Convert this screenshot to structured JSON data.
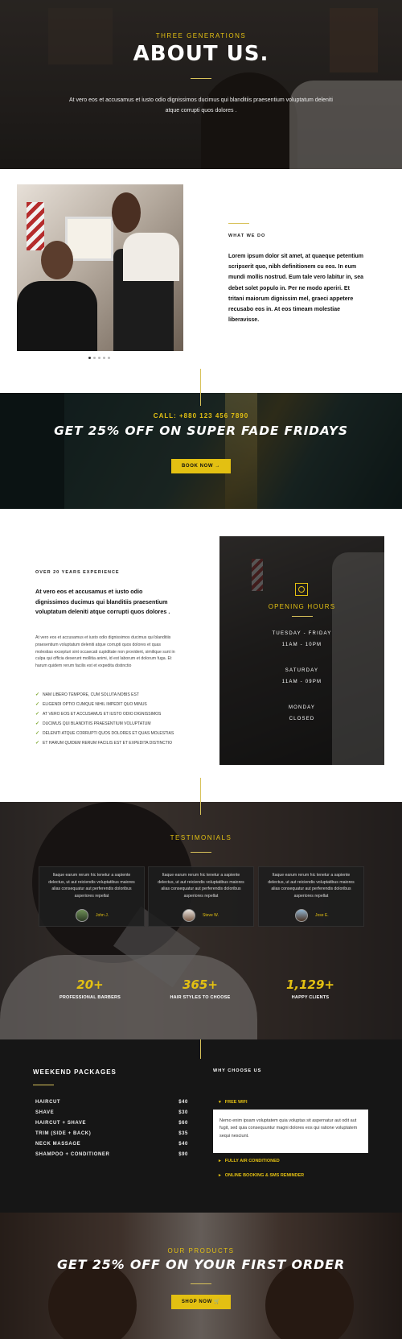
{
  "hero": {
    "eyebrow": "THREE GENERATIONS",
    "title": "ABOUT US.",
    "subtitle_line1": "At vero eos et accusamus et iusto odio dignissimos ducimus qui blanditiis praesentium voluptatum deleniti",
    "subtitle_line2": "atque corrupti quos dolores ."
  },
  "about": {
    "eyebrow": "WHAT WE DO",
    "body": "Lorem ipsum dolor sit amet, at quaeque petentium scripserit quo, nibh definitionem cu eos. In eum mundi mollis nostrud. Eum tale vero labitur in, sea debet solet populo in. Per ne modo aperiri. Et tritani maiorum dignissim mel, graeci appetere recusabo eos in. At eos timeam molestiae liberavisse."
  },
  "promo": {
    "call": "CALL: +880 123 456 7890",
    "title": "GET 25% OFF ON SUPER FADE FRIDAYS",
    "button": "BOOK NOW →"
  },
  "experience": {
    "eyebrow": "OVER 20 YEARS EXPERIENCE",
    "lead": "At vero eos et accusamus et iusto odio dignissimos ducimus qui blanditiis praesentium voluptatum deleniti atque corrupti quos dolores .",
    "body": "At vero eos et accusamus et iusto odio dignissimos ducimus qui blanditiis praesentium voluptatum deleniti atque corrupti quos dolores et quas molestias excepturi sint occaecati cupiditate non provident, similique sunt in culpa qui officia deserunt mollitia animi, id est laborum et dolorum fuga. Et harum quidem rerum facilis est et expedita distinctio",
    "checks": [
      "NAM LIBERO TEMPORE, CUM SOLUTA NOBIS EST",
      "ELIGENDI OPTIO CUMQUE NIHIL IMPEDIT QUO MINUS",
      "AT VERO EOS ET ACCUSAMUS ET IUSTO ODIO DIGNISSIMOS",
      "DUCIMUS QUI BLANDITIIS PRAESENTIUM VOLUPTATUM",
      "DELENITI ATQUE CORRUPTI QUOS DOLORES ET QUAS MOLESTIAS",
      "ET HARUM QUIDEM RERUM FACILIS EST ET EXPEDITA DISTINCTIO"
    ]
  },
  "hours": {
    "title": "OPENING HOURS",
    "weekdays": "TUESDAY - FRIDAY",
    "weekdays_time": "11AM - 10PM",
    "saturday": "SATURDAY",
    "saturday_time": "11AM - 09PM",
    "monday": "MONDAY",
    "monday_time": "CLOSED"
  },
  "testimonials": {
    "title": "TESTIMONIALS",
    "quote": "Itaque earum rerum hic tenetur a sapiente delectus, ut aut reiciendis voluptatibus maiores alias consequatur aut perferendis doloribus asperiores repellat",
    "names": [
      "John J.",
      "Steve W.",
      "Jose E."
    ]
  },
  "stats": [
    {
      "value": "20+",
      "label": "PROFESSIONAL BARBERS"
    },
    {
      "value": "365+",
      "label": "HAIR STYLES TO CHOOSE"
    },
    {
      "value": "1,129+",
      "label": "HAPPY CLIENTS"
    }
  ],
  "packages": {
    "title": "WEEKEND PACKAGES",
    "items": [
      {
        "name": "HAIRCUT",
        "price": "$40"
      },
      {
        "name": "SHAVE",
        "price": "$30"
      },
      {
        "name": "HAIRCUT + SHAVE",
        "price": "$60"
      },
      {
        "name": "TRIM (SIDE + BACK)",
        "price": "$35"
      },
      {
        "name": "NECK MASSAGE",
        "price": "$40"
      },
      {
        "name": "SHAMPOO + CONDITIONER",
        "price": "$90"
      }
    ]
  },
  "why": {
    "title": "WHY CHOOSE US",
    "accordion": [
      {
        "label": "FREE WIFI",
        "body": "Nemo enim ipsam voluptatem quia voluptas sit aspernatur aut odit aut fugit, sed quia consequuntur magni dolores eos qui ratione voluptatem sequi nesciunt."
      },
      {
        "label": "FULLY AIR CONDITIONED"
      },
      {
        "label": "ONLINE BOOKING & SMS REMINDER"
      }
    ]
  },
  "products": {
    "eyebrow": "OUR PRODUCTS",
    "title": "GET 25% OFF ON YOUR FIRST ORDER",
    "button": "SHOP NOW 🛒"
  },
  "colors": {
    "accent": "#e3c012",
    "dark": "#161616"
  }
}
